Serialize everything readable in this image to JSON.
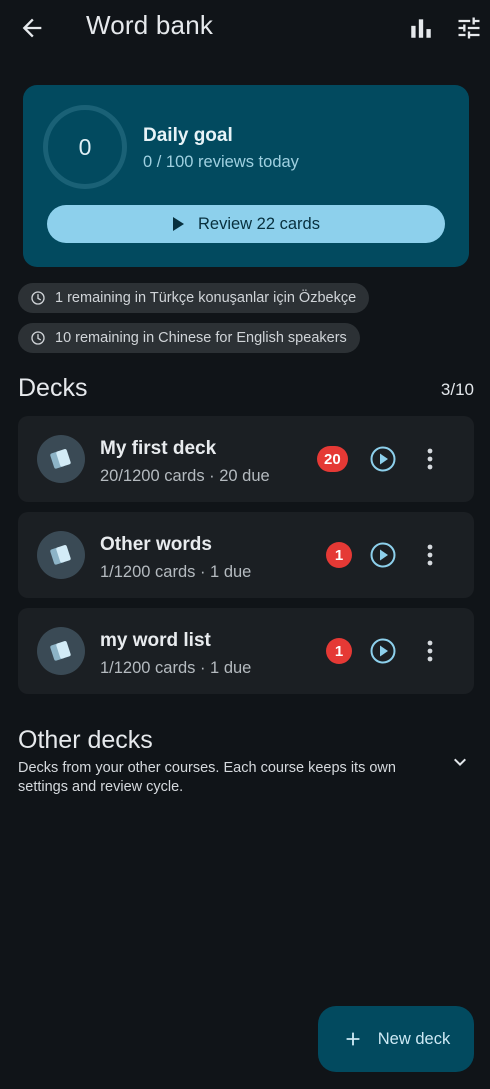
{
  "appbar": {
    "title": "Word bank",
    "back_icon": "arrow-back-icon",
    "stats_icon": "bar-chart-icon",
    "settings_icon": "tune-icon"
  },
  "goal": {
    "count": "0",
    "title": "Daily goal",
    "subtitle": "0 / 100 reviews today",
    "progress": 0,
    "review_button": "Review 22 cards"
  },
  "remaining": [
    "1 remaining in Türkçe konuşanlar için Özbekçe",
    "10 remaining in Chinese for English speakers"
  ],
  "decks_section": {
    "title": "Decks",
    "count": "3/10",
    "items": [
      {
        "name": "My first deck",
        "meta": "20/1200 cards · 20 due",
        "due": "20"
      },
      {
        "name": "Other words",
        "meta": "1/1200 cards · 1 due",
        "due": "1"
      },
      {
        "name": "my word list",
        "meta": "1/1200 cards · 1 due",
        "due": "1"
      }
    ]
  },
  "other_decks": {
    "title": "Other decks",
    "description": "Decks from your other courses. Each course keeps its own settings and review cycle."
  },
  "fab": {
    "label": "New deck"
  },
  "colors": {
    "background": "#101418",
    "card": "#024a5f",
    "accent": "#8dd0ec",
    "badge": "#e53935"
  }
}
